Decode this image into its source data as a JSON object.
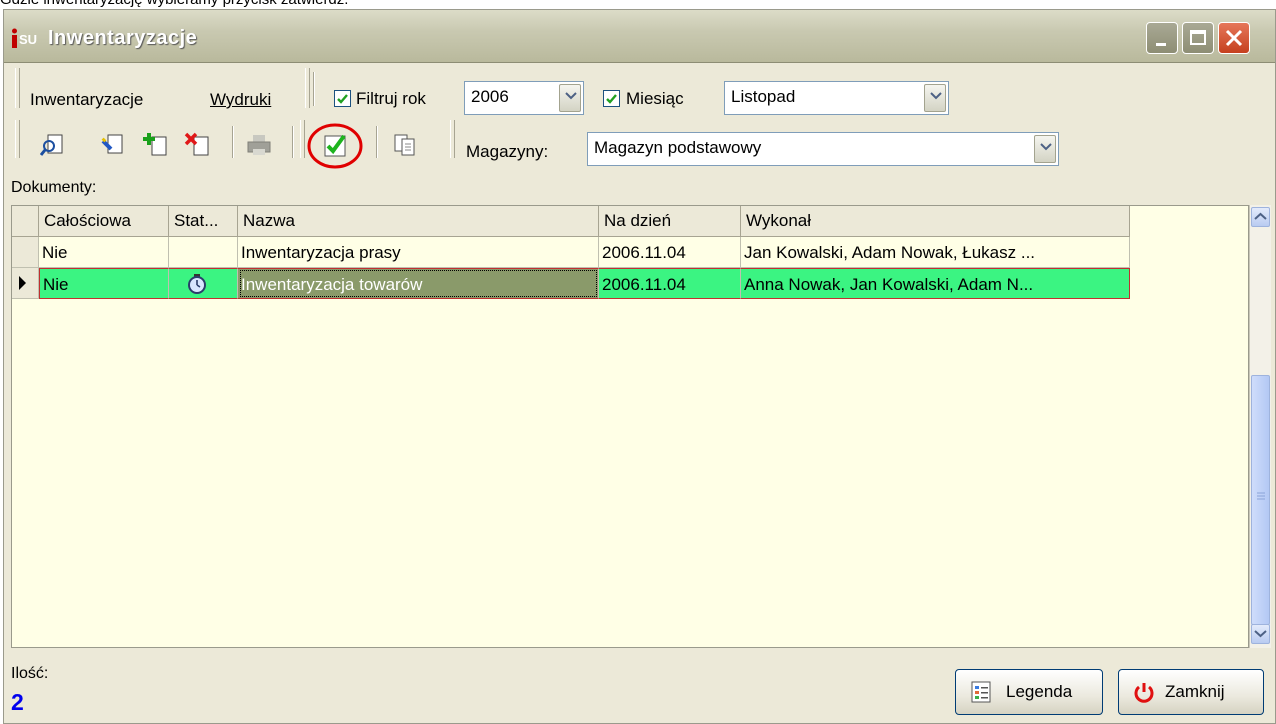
{
  "caption": "Gdzie inwentaryzację wybieramy przycisk zatwierdź.",
  "window": {
    "title": "Inwentaryzacje",
    "app_logo": "SU"
  },
  "menu": {
    "inwentaryzacje": "Inwentaryzacje",
    "wydruki": "Wydruki"
  },
  "filters": {
    "year_label": "Filtruj rok",
    "year_checked": true,
    "year_value": "2006",
    "month_label": "Miesiąc",
    "month_checked": true,
    "month_value": "Listopad"
  },
  "toolbar": {
    "icons": [
      "preview-icon",
      "edit-icon",
      "add-icon",
      "delete-icon",
      "print-icon",
      "approve-icon",
      "copy-icon"
    ],
    "warehouse_label": "Magazyny:",
    "warehouse_value": "Magazyn podstawowy"
  },
  "documents_label": "Dokumenty:",
  "table": {
    "columns": [
      "Całościowa",
      "Stat...",
      "Nazwa",
      "Na dzień",
      "Wykonał"
    ],
    "rows": [
      {
        "calosciowa": "Nie",
        "status": "",
        "nazwa": "Inwentaryzacja prasy",
        "na_dzien": "2006.11.04",
        "wykonal": "Jan Kowalski, Adam Nowak, Łukasz ..."
      },
      {
        "calosciowa": "Nie",
        "status": "clock-icon",
        "nazwa": "Inwentaryzacja towarów",
        "na_dzien": "2006.11.04",
        "wykonal": "Anna Nowak, Jan Kowalski, Adam N..."
      }
    ]
  },
  "footer": {
    "count_label": "Ilość:",
    "count_value": "2",
    "legend_button": "Legenda",
    "close_button": "Zamknij"
  },
  "colors": {
    "selected_row": "#3bf482",
    "selected_cell": "#8a9a6a",
    "grid_bg": "#ffffe6",
    "highlight_circle": "#e00000"
  }
}
